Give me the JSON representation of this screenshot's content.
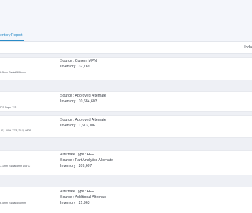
{
  "tabs": [
    {
      "label": "entory Report",
      "active": true
    }
  ],
  "toolbar": {
    "label": "Upda"
  },
  "rows": [
    {
      "description": "6.5mm Radial 5.08mm",
      "details": [
        {
          "label": "Source",
          "value": "Current MPN"
        },
        {
          "label": "Inventory",
          "value": "32,769"
        }
      ]
    },
    {
      "description": "5°C Paper T/R",
      "details": [
        {
          "label": "Source",
          "value": "Approved Alternate"
        },
        {
          "label": "Inventory",
          "value": "10,684,603"
        }
      ]
    },
    {
      "description": "- F, - 10%, X7R, 25 V, 0805",
      "details": [
        {
          "label": "Source",
          "value": "Approved Alternate"
        },
        {
          "label": "Inventory",
          "value": "1,613,006"
        }
      ]
    },
    {
      "description": "7.1mm Radial 5mm 105°C",
      "details": [
        {
          "label": "Alternate Type",
          "value": "FFF"
        },
        {
          "label": "Source",
          "value": "Part Analytics Alternate"
        },
        {
          "label": "Inventory",
          "value": "209,607"
        }
      ]
    },
    {
      "description": "6.5mm Radial 5.08mm",
      "details": [
        {
          "label": "Alternate Type",
          "value": "FFF"
        },
        {
          "label": "Source",
          "value": "Additional Alternate"
        },
        {
          "label": "Inventory",
          "value": "21,963"
        }
      ]
    }
  ],
  "colors": {
    "accent": "#2a8bc7",
    "page_background": "#f4f6fb",
    "group_separator": "#eef0f5",
    "text": "#3a3f48"
  }
}
